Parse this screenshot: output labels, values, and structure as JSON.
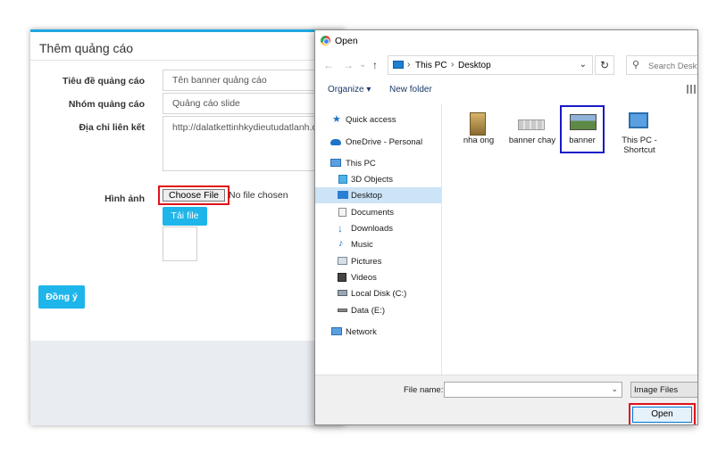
{
  "webform": {
    "title": "Thêm quảng cáo",
    "fields": [
      {
        "label": "Tiêu đề quảng cáo",
        "value": "Tên banner quảng cáo"
      },
      {
        "label": "Nhóm quảng cáo",
        "value": "Quảng cáo slide"
      },
      {
        "label": "Địa chỉ liên kết",
        "value": "http://dalatkettinhkydieutudatlanh.com"
      }
    ],
    "image_label": "Hình ảnh",
    "choose_file_label": "Choose File",
    "no_file_text": "No file chosen",
    "upload_label": "Tải file",
    "submit_label": "Đồng ý"
  },
  "dialog": {
    "title": "Open",
    "breadcrumb": [
      "This PC",
      "Desktop"
    ],
    "search_placeholder": "Search Desktop",
    "organize_label": "Organize ▾",
    "new_folder_label": "New folder",
    "nav_items": [
      {
        "label": "Quick access",
        "icon": "star-icon"
      },
      {
        "label": "OneDrive - Personal",
        "icon": "cloud-icon"
      },
      {
        "label": "This PC",
        "icon": "computer-icon"
      },
      {
        "label": "3D Objects",
        "icon": "cube-icon"
      },
      {
        "label": "Desktop",
        "icon": "desktop-icon",
        "selected": true
      },
      {
        "label": "Documents",
        "icon": "document-icon"
      },
      {
        "label": "Downloads",
        "icon": "download-icon"
      },
      {
        "label": "Music",
        "icon": "music-icon"
      },
      {
        "label": "Pictures",
        "icon": "picture-icon"
      },
      {
        "label": "Videos",
        "icon": "video-icon"
      },
      {
        "label": "Local Disk (C:)",
        "icon": "drive-icon"
      },
      {
        "label": "Data (E:)",
        "icon": "drive-icon"
      },
      {
        "label": "Network",
        "icon": "network-icon"
      }
    ],
    "files": [
      {
        "name": "nha ong",
        "type": "image"
      },
      {
        "name": "banner chay",
        "type": "image"
      },
      {
        "name": "banner",
        "type": "image",
        "selected": true
      },
      {
        "name": "This PC - Shortcut",
        "type": "shortcut"
      }
    ],
    "file_name_label": "File name:",
    "file_name_value": "",
    "file_type_value": "Image Files",
    "open_label": "Open"
  },
  "colors": {
    "accent": "#1eb5ea",
    "highlight_red": "#e0121b",
    "selection_blue": "#1919c8",
    "nav_selected": "#cce4f7"
  }
}
